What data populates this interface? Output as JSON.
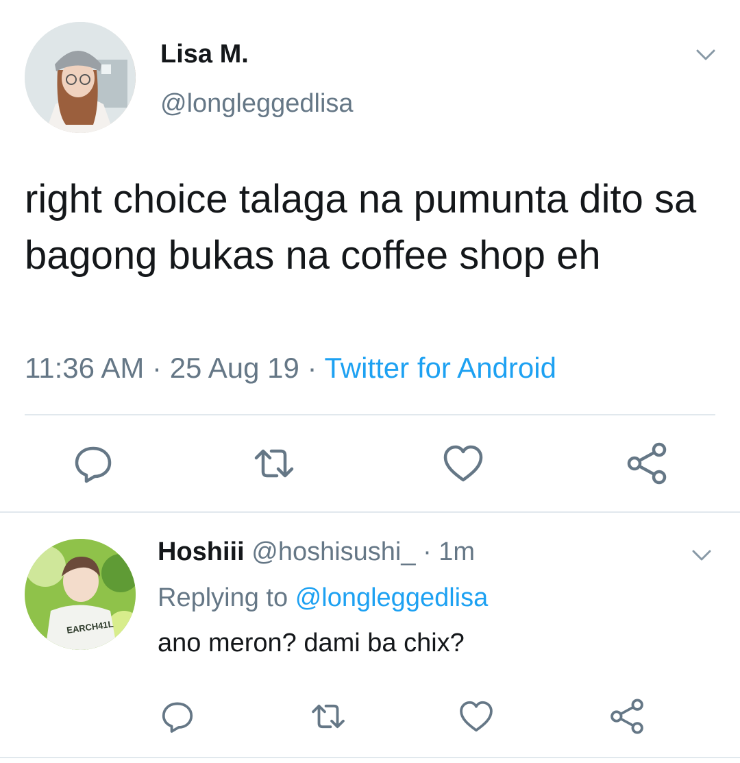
{
  "tweet": {
    "author_name": "Lisa M.",
    "author_handle": "@longleggedlisa",
    "text": "right choice talaga na pumunta dito sa bagong bukas na coffee shop eh",
    "time": "11:36 AM",
    "separator": "·",
    "date": "25 Aug 19",
    "source": "Twitter for Android",
    "avatar_icon": "profile-photo",
    "menu_icon": "chevron-down-icon"
  },
  "actions": {
    "reply_icon": "reply-icon",
    "retweet_icon": "retweet-icon",
    "like_icon": "heart-icon",
    "share_icon": "share-icon"
  },
  "reply": {
    "author_name": "Hoshiii",
    "author_handle": "@hoshisushi_",
    "separator": "·",
    "time": "1m",
    "replying_prefix": "Replying to",
    "replying_to": "@longleggedlisa",
    "text": "ano meron? dami ba chix?",
    "avatar_icon": "profile-photo",
    "avatar_shirt_text": "EARCH41L"
  },
  "colors": {
    "text_primary": "#14171a",
    "text_secondary": "#657786",
    "link_blue": "#1da1f2",
    "divider": "#e1e8ed",
    "icon_gray": "#657786"
  }
}
